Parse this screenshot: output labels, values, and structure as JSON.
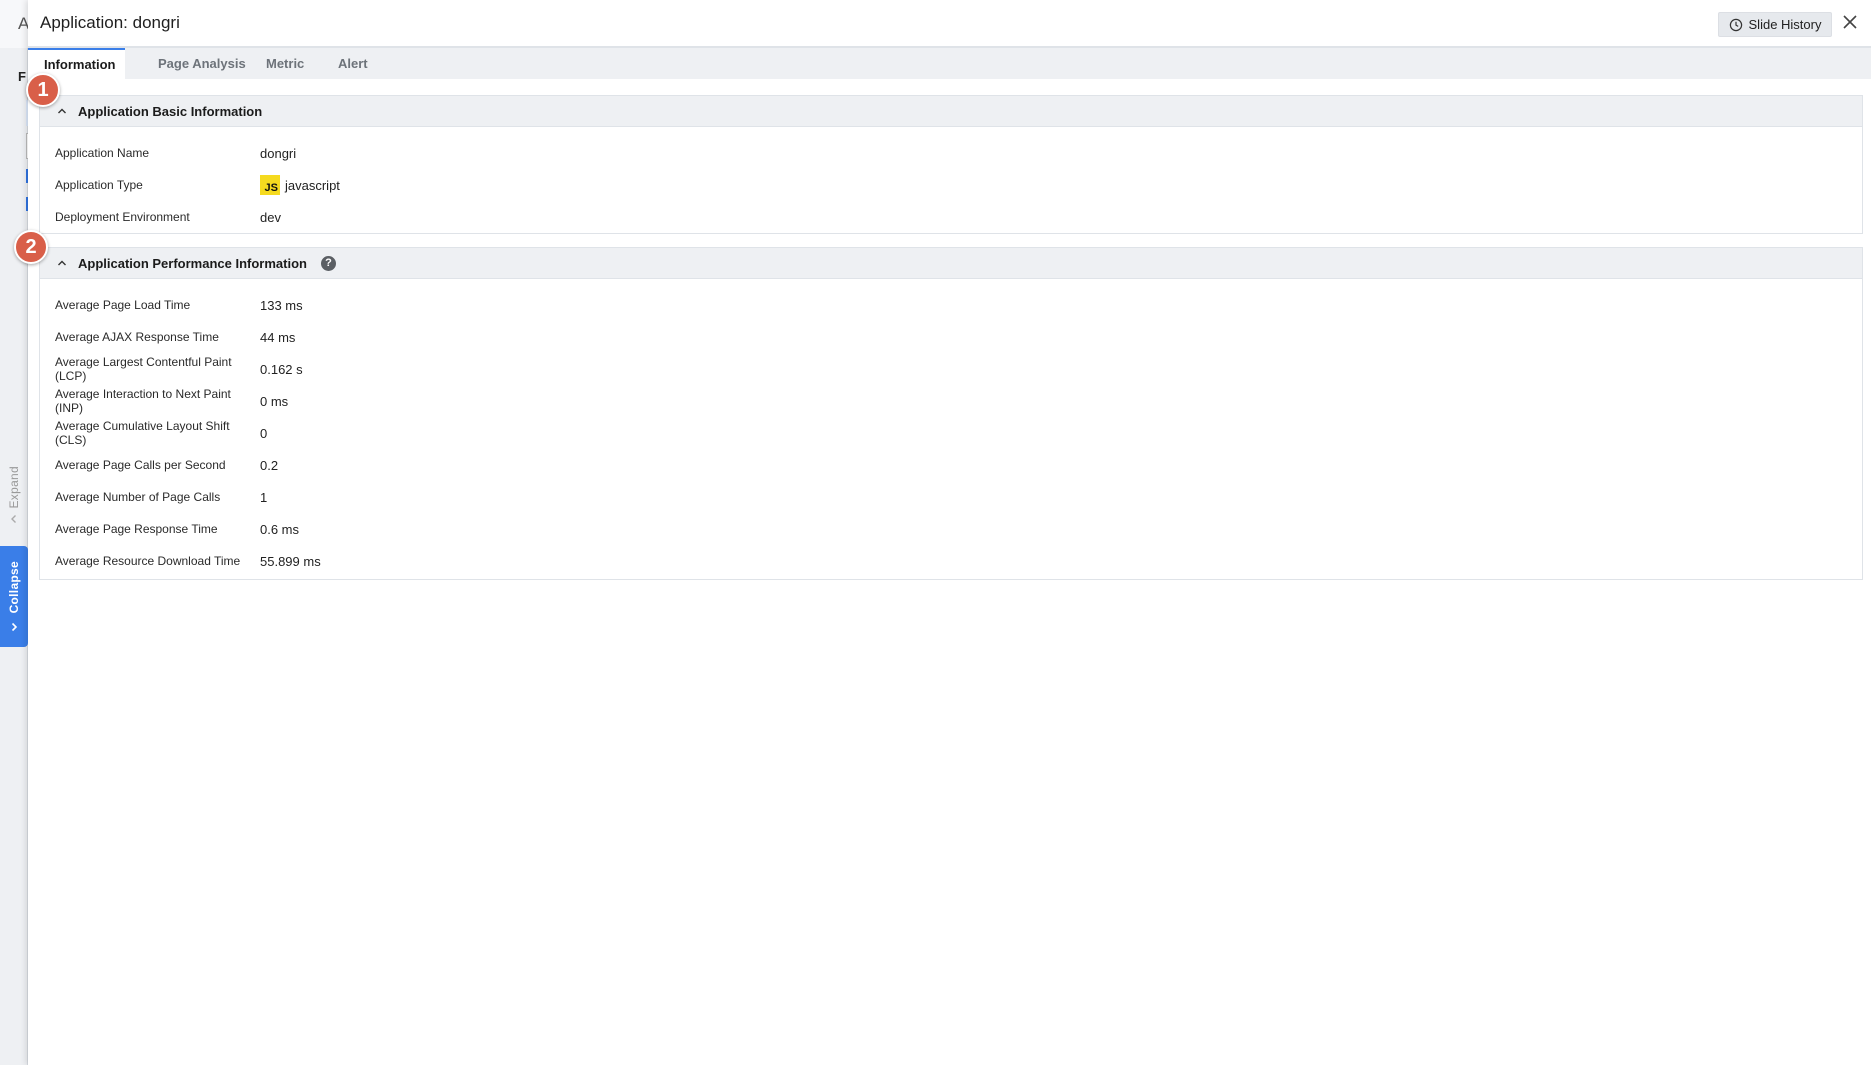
{
  "background": {
    "title_fragment": "A",
    "tab_fragment": "F"
  },
  "side_tabs": {
    "expand_label": "Expand",
    "collapse_label": "Collapse"
  },
  "panel": {
    "title": "Application: dongri",
    "slide_history_label": "Slide History",
    "tabs": [
      {
        "label": "Information",
        "active": true
      },
      {
        "label": "Page Analysis",
        "active": false
      },
      {
        "label": "Metric",
        "active": false
      },
      {
        "label": "Alert",
        "active": false
      }
    ]
  },
  "basic_info": {
    "title": "Application Basic Information",
    "rows": [
      {
        "label": "Application Name",
        "value": "dongri"
      },
      {
        "label": "Application Type",
        "value": "javascript",
        "badge": "JS"
      },
      {
        "label": "Deployment Environment",
        "value": "dev"
      }
    ]
  },
  "performance_info": {
    "title": "Application Performance Information",
    "help_glyph": "?",
    "rows": [
      {
        "label": "Average Page Load Time",
        "value": "133 ms"
      },
      {
        "label": "Average AJAX Response Time",
        "value": "44 ms"
      },
      {
        "label": "Average Largest Contentful Paint (LCP)",
        "value": "0.162 s"
      },
      {
        "label": "Average Interaction to Next Paint (INP)",
        "value": "0 ms"
      },
      {
        "label": "Average Cumulative Layout Shift (CLS)",
        "value": "0"
      },
      {
        "label": "Average Page Calls per Second",
        "value": "0.2"
      },
      {
        "label": "Average Number of Page Calls",
        "value": "1"
      },
      {
        "label": "Average Page Response Time",
        "value": "0.6 ms"
      },
      {
        "label": "Average Resource Download Time",
        "value": "55.899 ms"
      }
    ]
  },
  "callouts": [
    "1",
    "2"
  ],
  "colors": {
    "accent": "#3a7ee8",
    "callout": "#d95f49",
    "js_badge": "#f5da1f"
  }
}
